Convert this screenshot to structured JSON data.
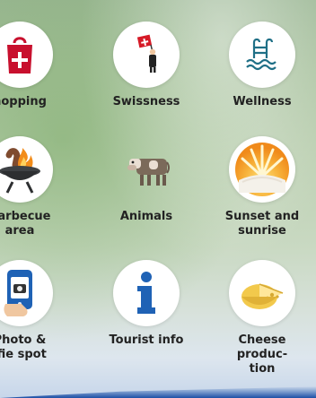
{
  "tiles": [
    {
      "label": "hopping",
      "icon": "shopping-bag-icon"
    },
    {
      "label": "Swissness",
      "icon": "swiss-flag-person-icon"
    },
    {
      "label": "Wellness",
      "icon": "pool-ladder-icon"
    },
    {
      "label": "Barbecue\narea",
      "icon": "grill-icon"
    },
    {
      "label": "Animals",
      "icon": "cow-icon"
    },
    {
      "label": "Sunset and\nsunrise",
      "icon": "sun-icon"
    },
    {
      "label": "Photo &\nlfie spot",
      "icon": "smartphone-icon"
    },
    {
      "label": "Tourist info",
      "icon": "info-icon"
    },
    {
      "label": "Cheese produc-\ntion",
      "icon": "cheese-icon"
    }
  ],
  "colors": {
    "shopping_red": "#c8102e",
    "wellness_teal": "#1f6f86",
    "info_blue": "#1f62b5",
    "sun_orange": "#f0a31e",
    "cheese_yellow": "#f2c94c"
  }
}
